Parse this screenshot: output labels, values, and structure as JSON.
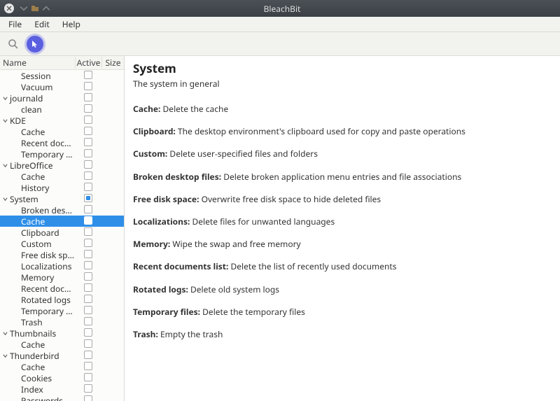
{
  "window": {
    "title": "BleachBit"
  },
  "menu": {
    "file": "File",
    "edit": "Edit",
    "help": "Help"
  },
  "toolbar": {
    "search_icon": "search-icon",
    "play_icon": "play-icon"
  },
  "tree": {
    "columns": {
      "name": "Name",
      "active": "Active",
      "size": "Size"
    },
    "rows": [
      {
        "label": "Session",
        "type": "child"
      },
      {
        "label": "Vacuum",
        "type": "child"
      },
      {
        "label": "journald",
        "type": "parent",
        "expanded": true
      },
      {
        "label": "clean",
        "type": "child"
      },
      {
        "label": "KDE",
        "type": "parent",
        "expanded": true
      },
      {
        "label": "Cache",
        "type": "child"
      },
      {
        "label": "Recent documents list",
        "type": "child"
      },
      {
        "label": "Temporary files",
        "type": "child"
      },
      {
        "label": "LibreOffice",
        "type": "parent",
        "expanded": true
      },
      {
        "label": "Cache",
        "type": "child"
      },
      {
        "label": "History",
        "type": "child"
      },
      {
        "label": "System",
        "type": "parent",
        "expanded": true,
        "active_state": "partial"
      },
      {
        "label": "Broken desktop files",
        "type": "child"
      },
      {
        "label": "Cache",
        "type": "child",
        "selected": true
      },
      {
        "label": "Clipboard",
        "type": "child"
      },
      {
        "label": "Custom",
        "type": "child"
      },
      {
        "label": "Free disk space",
        "type": "child"
      },
      {
        "label": "Localizations",
        "type": "child"
      },
      {
        "label": "Memory",
        "type": "child"
      },
      {
        "label": "Recent documents list",
        "type": "child"
      },
      {
        "label": "Rotated logs",
        "type": "child"
      },
      {
        "label": "Temporary files",
        "type": "child"
      },
      {
        "label": "Trash",
        "type": "child"
      },
      {
        "label": "Thumbnails",
        "type": "parent",
        "expanded": true
      },
      {
        "label": "Cache",
        "type": "child"
      },
      {
        "label": "Thunderbird",
        "type": "parent",
        "expanded": true
      },
      {
        "label": "Cache",
        "type": "child"
      },
      {
        "label": "Cookies",
        "type": "child"
      },
      {
        "label": "Index",
        "type": "child"
      },
      {
        "label": "Passwords",
        "type": "child"
      }
    ]
  },
  "main": {
    "title": "System",
    "subtitle": "The system in general",
    "defs": [
      {
        "term": "Cache:",
        "desc": "Delete the cache"
      },
      {
        "term": "Clipboard:",
        "desc": "The desktop environment's clipboard used for copy and paste operations"
      },
      {
        "term": "Custom:",
        "desc": "Delete user-specified files and folders"
      },
      {
        "term": "Broken desktop files:",
        "desc": "Delete broken application menu entries and file associations"
      },
      {
        "term": "Free disk space:",
        "desc": "Overwrite free disk space to hide deleted files"
      },
      {
        "term": "Localizations:",
        "desc": "Delete files for unwanted languages"
      },
      {
        "term": "Memory:",
        "desc": "Wipe the swap and free memory"
      },
      {
        "term": "Recent documents list:",
        "desc": "Delete the list of recently used documents"
      },
      {
        "term": "Rotated logs:",
        "desc": "Delete old system logs"
      },
      {
        "term": "Temporary files:",
        "desc": "Delete the temporary files"
      },
      {
        "term": "Trash:",
        "desc": "Empty the trash"
      }
    ]
  }
}
